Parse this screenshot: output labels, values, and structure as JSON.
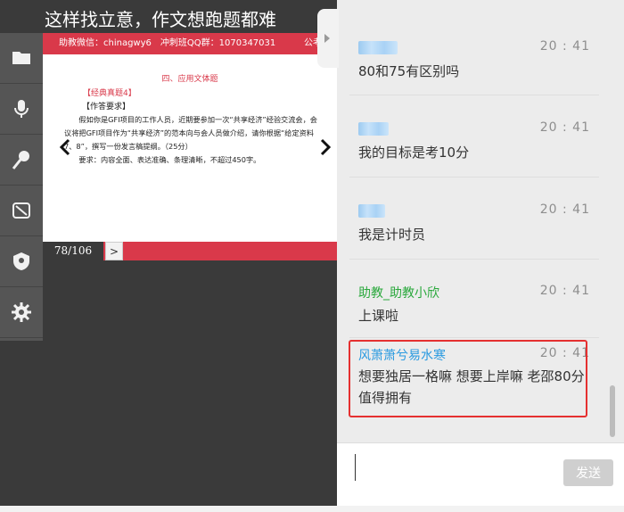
{
  "video": {
    "title": "这样找立意，作文想跑题都难",
    "slide_header": {
      "assistant_wechat": "助教微信：chinagwy6",
      "group": "冲刺班QQ群：1070347031",
      "right": "公考"
    },
    "slide": {
      "title": "四、应用文体题",
      "tag": "【经典真题4】",
      "requirement_label": "【作答要求】",
      "body_1": "假如你是GFI项目的工作人员，近期要参加一次“共享经济”经验交流会，会议将把GFI项目作为“共享经济”的范本向与会人员做介绍，请你根据“给定资料7、8”，撰写一份发言稿提纲。（25分）",
      "body_2": "要求：内容全面、表达准确、条理清晰，不超过450字。"
    },
    "pager": {
      "page": "78/106",
      "next": ">"
    }
  },
  "sidebar_icons": [
    "folder-icon",
    "microphone-icon",
    "mic-handheld-icon",
    "block-icon",
    "shield-icon",
    "gear-icon"
  ],
  "chat": {
    "messages": [
      {
        "time": "20 : 41",
        "text": "80和75有区别吗"
      },
      {
        "time": "20 : 41",
        "text": "我的目标是考10分"
      },
      {
        "time": "20 : 41",
        "text": "我是计时员"
      },
      {
        "name": "助教_助教小欣",
        "time": "20 : 41",
        "text": "上课啦"
      },
      {
        "name": "风萧萧兮易水寒",
        "time": "20 : 41",
        "text": "想要独居一格嘛 想要上岸嘛  老邵80分 值得拥有"
      }
    ],
    "send_label": "发送"
  },
  "colors": {
    "accent_red": "#d9394a",
    "assistant_name": "#2aa83c",
    "user_name": "#2a9ae0",
    "highlight": "#e53030"
  }
}
